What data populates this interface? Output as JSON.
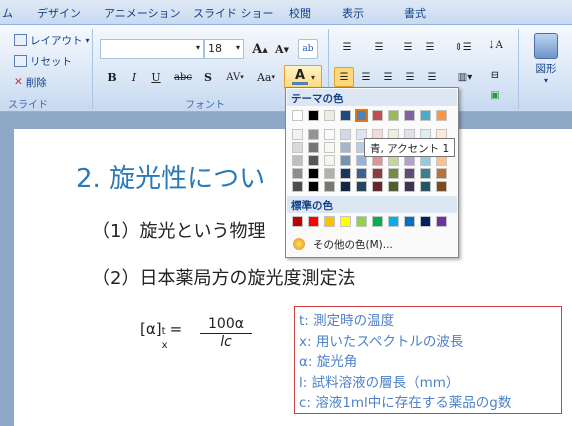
{
  "tabs": [
    "ム",
    "デザイン",
    "アニメーション",
    "スライド ショー",
    "校閲",
    "表示",
    "書式"
  ],
  "ribbon": {
    "layout_label": "レイアウト",
    "reset_label": "リセット",
    "delete_label": "削除",
    "slide_group": "スライド",
    "font_group": "フォント",
    "shapes_label": "図形",
    "font_name": "",
    "font_size": "18",
    "bold": "B",
    "italic": "I",
    "underline": "U",
    "strike": "abc",
    "shadow": "S",
    "spacing": "AV",
    "case": "Aa",
    "font_color": "A",
    "grow": "A",
    "shrink": "A"
  },
  "picker": {
    "theme_heading": "テーマの色",
    "standard_heading": "標準の色",
    "more_colors": "その他の色(M)...",
    "theme_top": [
      "#ffffff",
      "#000000",
      "#eeece1",
      "#1f497d",
      "#4f81bd",
      "#c0504d",
      "#9bbb59",
      "#8064a2",
      "#4bacc6",
      "#f79646"
    ],
    "standard": [
      "#c00000",
      "#ff0000",
      "#ffc000",
      "#ffff00",
      "#92d050",
      "#00b050",
      "#00b0f0",
      "#0070c0",
      "#002060",
      "#7030a0"
    ],
    "tooltip": "青, アクセント 1"
  },
  "slide": {
    "title": "2. 旋光性につい",
    "line1": "（1）旋光という物理",
    "line2": "（2）日本薬局方の旋光度測定法",
    "formula_lhs": "[α]",
    "formula_sup": "t",
    "formula_sub": "x",
    "formula_eq": "=",
    "numerator": "100α",
    "denominator": "lc",
    "legend": [
      "t: 測定時の温度",
      "x: 用いたスペクトルの波長",
      "α: 旋光角",
      "l: 試料溶液の層長（mm）",
      "c: 溶液1ml中に存在する薬品のg数"
    ]
  },
  "colors": {
    "accent": "#2a7ab8",
    "legend_text": "#4e82c8",
    "legend_border": "#d04040"
  }
}
